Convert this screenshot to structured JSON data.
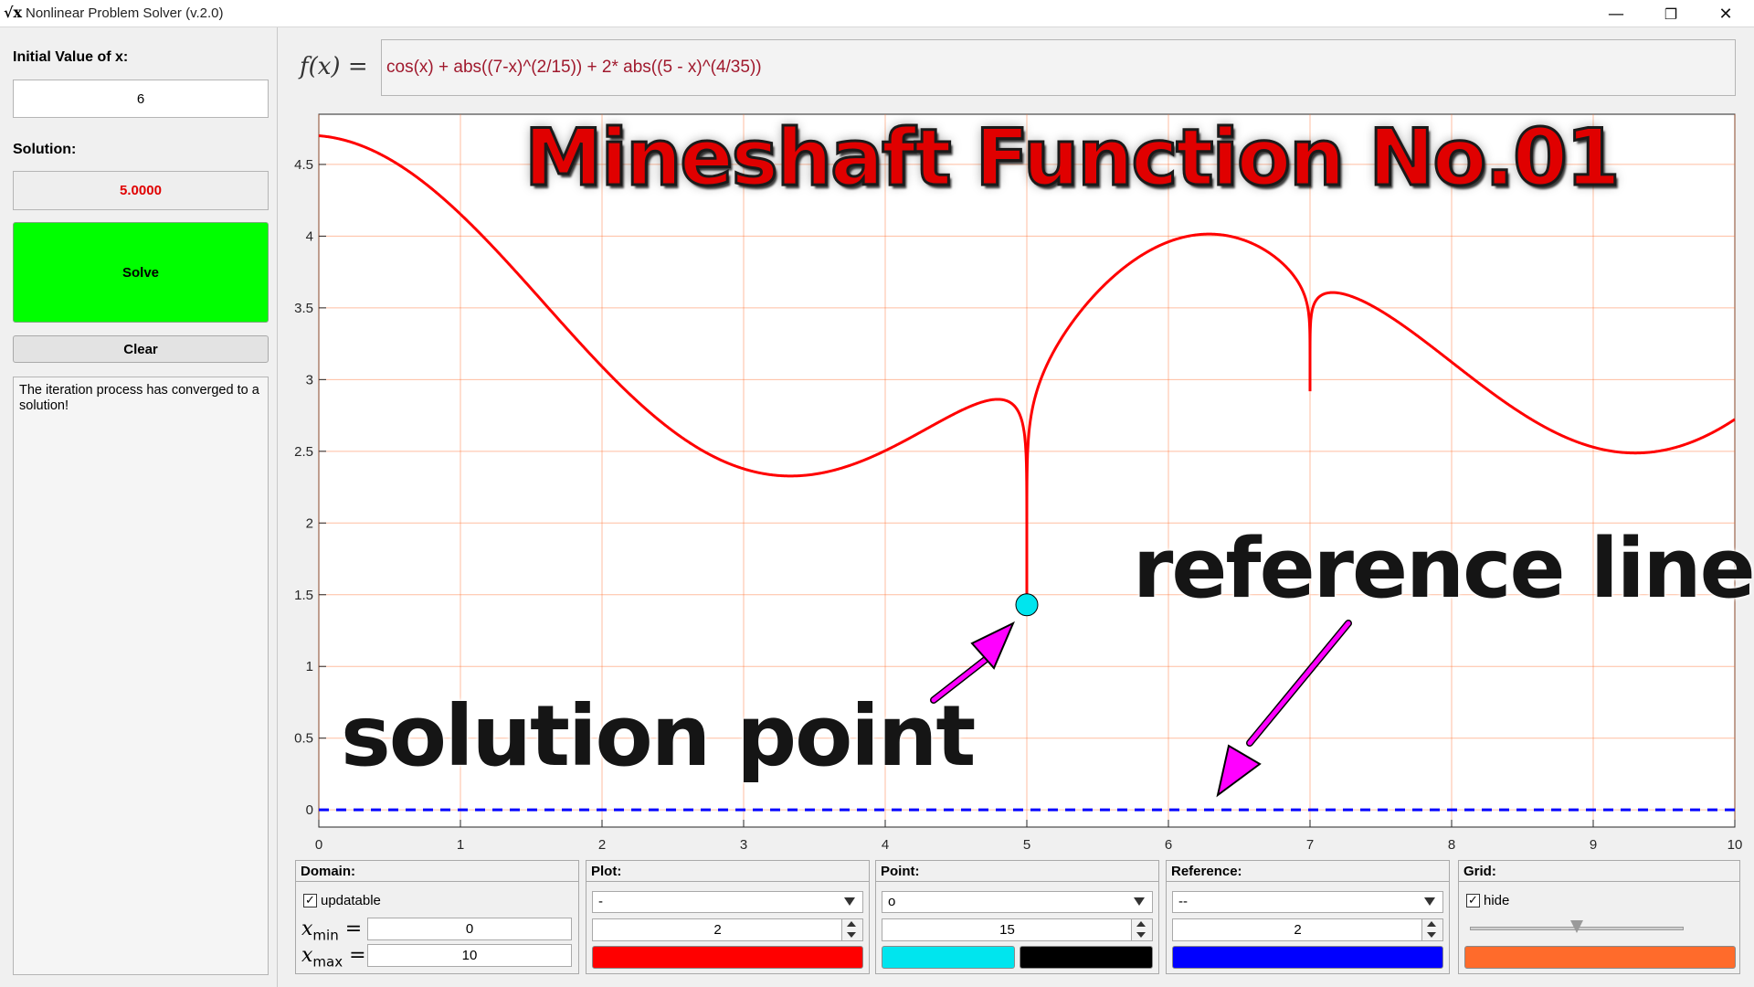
{
  "window": {
    "icon_text": "√x",
    "title": "Nonlinear Problem Solver (v.2.0)",
    "minimize_glyph": "—",
    "maximize_glyph": "❐",
    "close_glyph": "✕"
  },
  "left": {
    "initial_label": "Initial Value of x:",
    "initial_value": "6",
    "solution_label": "Solution:",
    "solution_value": "5.0000",
    "solve_label": "Solve",
    "clear_label": "Clear",
    "message": "The iteration process has converged to a solution!"
  },
  "formula": {
    "label": "f(x) =",
    "expression": "cos(x) + abs((7-x)^(2/15)) + 2* abs((5 - x)^(4/35))"
  },
  "overlays": {
    "title": "Mineshaft Function No.01",
    "solution_point": "solution point",
    "reference_line": "reference line"
  },
  "colors": {
    "curve": "#ff0000",
    "point_face": "#00e5ee",
    "point_edge": "#000000",
    "reference": "#0000ff",
    "grid": "#ff6f2c",
    "arrow": "#ff00ff",
    "solve_button": "#00ff00"
  },
  "chart_data": {
    "type": "line",
    "function": "cos(x) + abs((7-x)^(2/15)) + 2* abs((5 - x)^(4/35))",
    "xlim": [
      0,
      10
    ],
    "ylim": [
      -0.12,
      4.85
    ],
    "x_ticks": [
      0,
      1,
      2,
      3,
      4,
      5,
      6,
      7,
      8,
      9,
      10
    ],
    "y_ticks": [
      0,
      0.5,
      1,
      1.5,
      2,
      2.5,
      3,
      3.5,
      4,
      4.5
    ],
    "x_tick_labels": [
      "0",
      "1",
      "2",
      "3",
      "4",
      "5",
      "6",
      "7",
      "8",
      "9",
      "10"
    ],
    "y_tick_labels": [
      "0",
      "0.5",
      "1",
      "1.5",
      "2",
      "2.5",
      "3",
      "3.5",
      "4",
      "4.5"
    ],
    "grid": true,
    "solution_point": {
      "x": 5,
      "y": 1.43
    },
    "reference_line": {
      "y": 0,
      "style": "dashed"
    }
  },
  "panels": {
    "domain": {
      "title": "Domain:",
      "updatable_label": "updatable",
      "updatable_checked": true,
      "xmin_label": "x",
      "xmin_sub": "min",
      "xmax_label": "x",
      "xmax_sub": "max",
      "eq": "=",
      "xmin_value": "0",
      "xmax_value": "10"
    },
    "plot": {
      "title": "Plot:",
      "line_style": "-",
      "line_width": "2",
      "color": "#ff0000"
    },
    "point": {
      "title": "Point:",
      "marker": "o",
      "size": "15",
      "face_color": "#00e5ee",
      "edge_color": "#000000"
    },
    "reference": {
      "title": "Reference:",
      "line_style": "--",
      "line_width": "2",
      "color": "#0000ff"
    },
    "grid": {
      "title": "Grid:",
      "hide_label": "hide",
      "hide_checked": true,
      "slider_value": 0.5,
      "color": "#ff6b2b"
    }
  }
}
